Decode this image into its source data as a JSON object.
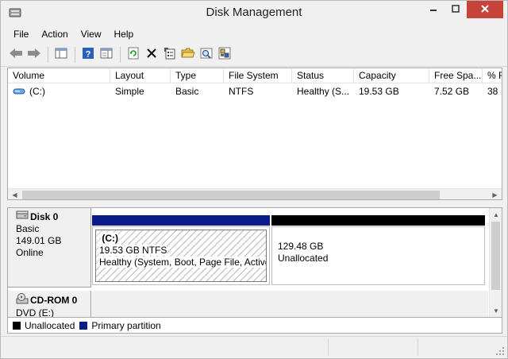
{
  "window": {
    "title": "Disk Management"
  },
  "menu": {
    "items": [
      "File",
      "Action",
      "View",
      "Help"
    ]
  },
  "toolbar": {
    "icons": [
      "back-arrow-icon",
      "forward-arrow-icon",
      "console-tree-icon",
      "help-icon",
      "properties-pane-icon",
      "refresh-icon",
      "delete-icon",
      "properties-icon",
      "open-folder-icon",
      "explore-icon",
      "settings-icon"
    ]
  },
  "volume_list": {
    "columns": [
      "Volume",
      "Layout",
      "Type",
      "File System",
      "Status",
      "Capacity",
      "Free Spa...",
      "% F"
    ],
    "rows": [
      {
        "volume": "(C:)",
        "layout": "Simple",
        "type": "Basic",
        "file_system": "NTFS",
        "status": "Healthy (S...",
        "capacity": "19.53 GB",
        "free_space": "7.52 GB",
        "percent_free": "38"
      }
    ]
  },
  "disks": {
    "disk0": {
      "name": "Disk 0",
      "kind": "Basic",
      "size": "149.01 GB",
      "state": "Online",
      "partitions": [
        {
          "label": "(C:)",
          "size_fs": "19.53 GB NTFS",
          "status": "Healthy (System, Boot, Page File, Active,",
          "color": "#0a1c8a"
        },
        {
          "size": "129.48 GB",
          "status": "Unallocated",
          "color": "#000000"
        }
      ]
    },
    "cdrom0": {
      "name": "CD-ROM 0",
      "kind": "DVD (E:)"
    }
  },
  "legend": {
    "items": [
      {
        "label": "Unallocated",
        "color": "#000000"
      },
      {
        "label": "Primary partition",
        "color": "#0a1c8a"
      }
    ]
  }
}
